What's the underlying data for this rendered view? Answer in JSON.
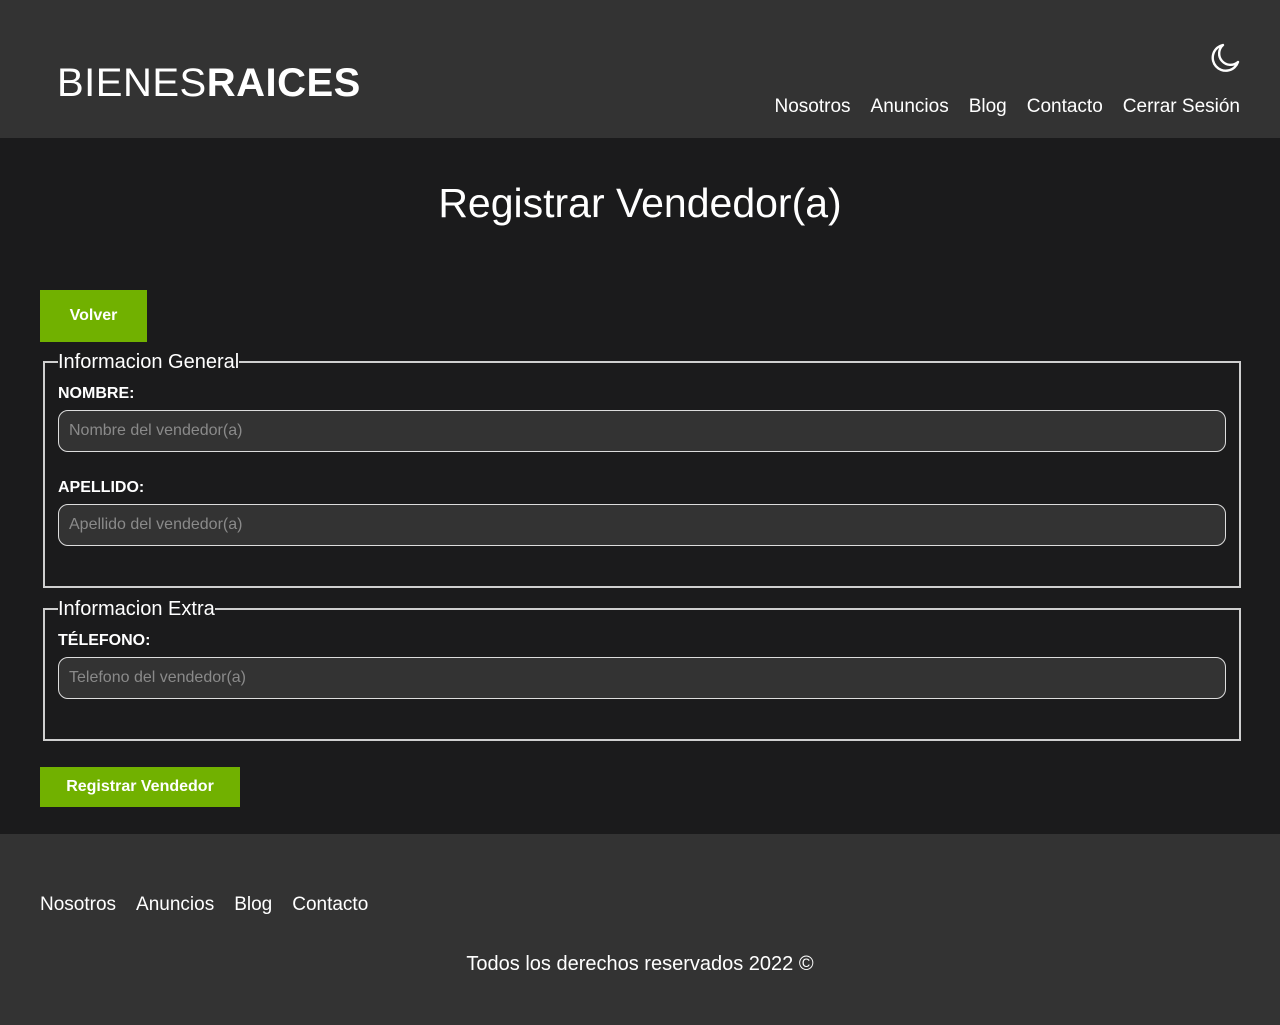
{
  "header": {
    "logo_light": "BIENES",
    "logo_bold": "RAICES",
    "dark_mode_icon": "moon-icon",
    "nav": [
      "Nosotros",
      "Anuncios",
      "Blog",
      "Contacto",
      "Cerrar Sesión"
    ]
  },
  "main": {
    "title": "Registrar Vendedor(a)",
    "back_button": "Volver",
    "general": {
      "legend": "Informacion General",
      "nombre_label": "NOMBRE:",
      "nombre_placeholder": "Nombre del vendedor(a)",
      "nombre_value": "",
      "apellido_label": "APELLIDO:",
      "apellido_placeholder": "Apellido del vendedor(a)",
      "apellido_value": ""
    },
    "extra": {
      "legend": "Informacion Extra",
      "telefono_label": "TÉLEFONO:",
      "telefono_placeholder": "Telefono del vendedor(a)",
      "telefono_value": ""
    },
    "submit_button": "Registrar Vendedor"
  },
  "footer": {
    "nav": [
      "Nosotros",
      "Anuncios",
      "Blog",
      "Contacto"
    ],
    "copyright": "Todos los derechos reservados 2022 ©"
  },
  "colors": {
    "header_bg": "#333333",
    "body_bg": "#1b1b1c",
    "accent_green": "#71b100",
    "input_bg": "#333333"
  }
}
